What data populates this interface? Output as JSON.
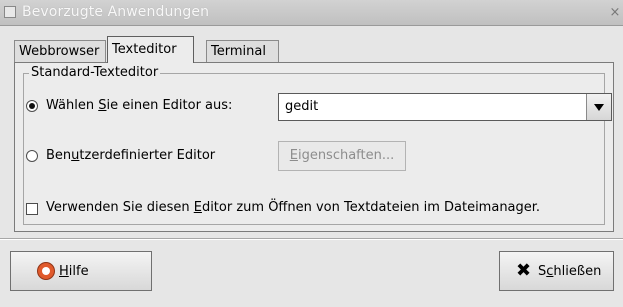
{
  "window": {
    "title": "Bevorzugte Anwendungen",
    "close_glyph": "×"
  },
  "tabs": {
    "webbrowser": "Webbrowser",
    "texteditor": "Texteditor",
    "terminal": "Terminal"
  },
  "group": {
    "title": "Standard-Texteditor",
    "option_select": {
      "before": "Wählen ",
      "mnemonic": "S",
      "after": "ie einen Editor aus:",
      "selected": true
    },
    "editor_combo": {
      "value": "gedit"
    },
    "option_custom": {
      "before": "Ben",
      "mnemonic": "u",
      "after": "tzerdefinierter Editor",
      "selected": false
    },
    "properties_button": {
      "mnemonic": "E",
      "after": "igenschaften..."
    },
    "open_checkbox": {
      "before": "Verwenden Sie diesen ",
      "mnemonic": "E",
      "after": "ditor zum Öffnen von Textdateien im Dateimanager.",
      "checked": false
    }
  },
  "buttons": {
    "help": {
      "mnemonic": "H",
      "after": "ilfe",
      "icon": "help-lifebuoy-icon"
    },
    "close": {
      "icon_glyph": "✖",
      "before": "S",
      "mnemonic": "c",
      "after": "hließen",
      "icon": "close-icon"
    }
  }
}
